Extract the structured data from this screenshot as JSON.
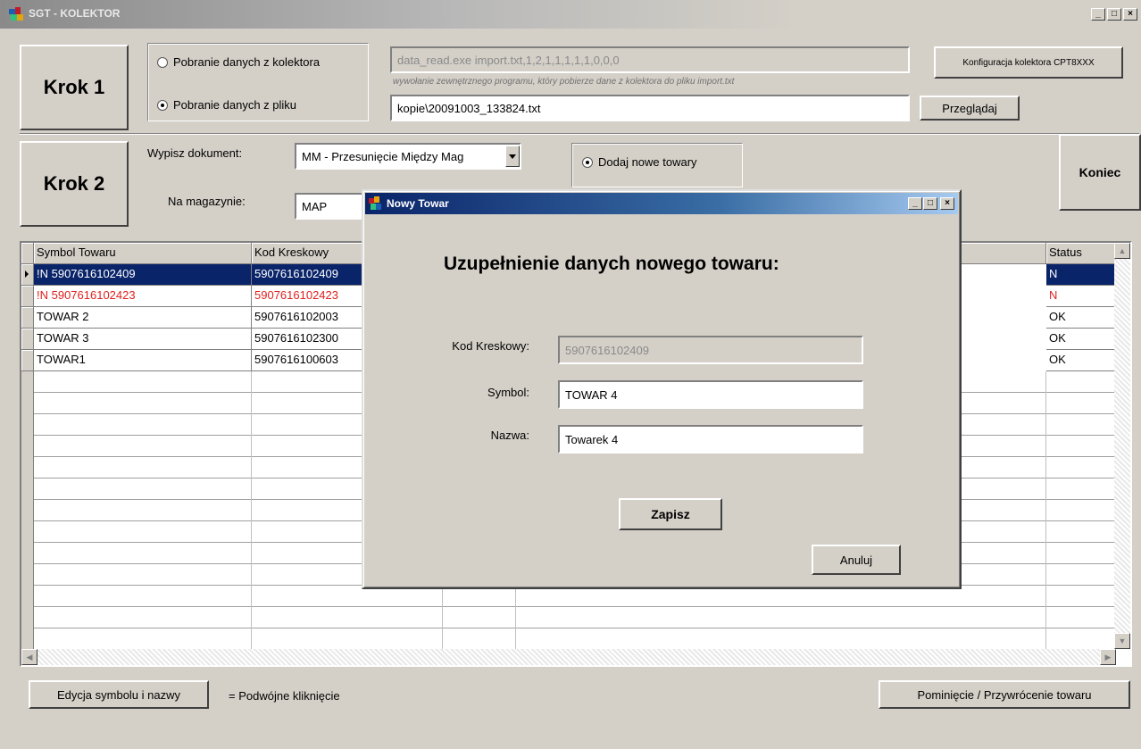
{
  "window": {
    "title": "SGT - KOLEKTOR",
    "controls": [
      "_",
      "□",
      "×"
    ]
  },
  "step1": {
    "label": "Krok 1",
    "radio_collector": "Pobranie danych z kolektora",
    "radio_file": "Pobranie danych z pliku",
    "command_value": "data_read.exe import.txt,1,2,1,1,1,1,1,0,0,0",
    "command_hint": "wywołanie zewnętrznego programu, który pobierze dane z kolektora do pliku import.txt",
    "file_value": "kopie\\20091003_133824.txt",
    "browse_button": "Przeglądaj",
    "config_button": "Konfiguracja kolektora CPT8XXX"
  },
  "step2": {
    "label": "Krok 2",
    "doc_label": "Wypisz dokument:",
    "doc_value": "MM - Przesunięcie Między Mag",
    "warehouse_label": "Na magazynie:",
    "warehouse_value": "MAP",
    "radio_add": "Dodaj nowe towary",
    "end_button": "Koniec"
  },
  "grid": {
    "columns": {
      "symbol": "Symbol Towaru",
      "barcode": "Kod Kreskowy",
      "status": "Status"
    },
    "rows": [
      {
        "symbol": "!N 5907616102409",
        "barcode": "5907616102409",
        "status": "N"
      },
      {
        "symbol": "!N 5907616102423",
        "barcode": "5907616102423",
        "status": "N"
      },
      {
        "symbol": "TOWAR 2",
        "barcode": "5907616102003",
        "status": "OK"
      },
      {
        "symbol": "TOWAR 3",
        "barcode": "5907616102300",
        "status": "OK"
      },
      {
        "symbol": "TOWAR1",
        "barcode": "5907616100603",
        "status": "OK"
      }
    ]
  },
  "bottom": {
    "edit_button": "Edycja symbolu i nazwy",
    "edit_hint": "= Podwójne kliknięcie",
    "skip_button": "Pominięcie / Przywrócenie towaru"
  },
  "dialog": {
    "title": "Nowy Towar",
    "heading": "Uzupełnienie danych nowego towaru:",
    "barcode_label": "Kod Kreskowy:",
    "barcode_value": "5907616102409",
    "symbol_label": "Symbol:",
    "symbol_value": "TOWAR 4",
    "name_label": "Nazwa:",
    "name_value": "Towarek 4",
    "save_button": "Zapisz",
    "cancel_button": "Anuluj"
  }
}
